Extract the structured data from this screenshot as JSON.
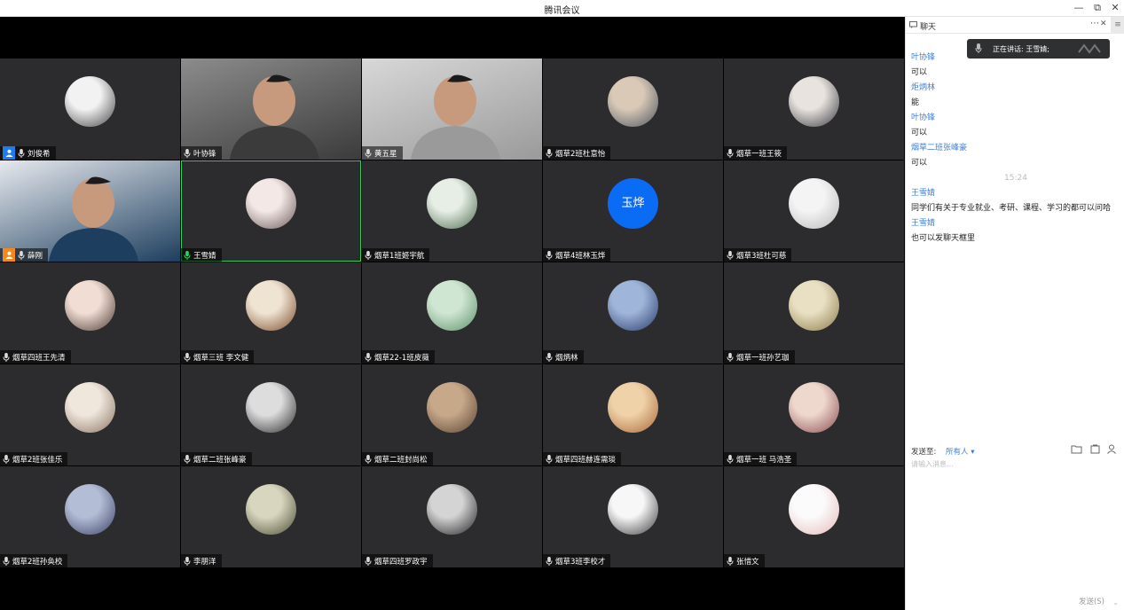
{
  "window": {
    "title": "腾讯会议",
    "minimize": "—",
    "restore": "⧉",
    "close": "✕"
  },
  "participants": [
    {
      "name": "刘俊希",
      "kind": "avatar",
      "color1": "#f2f2f2",
      "color2": "#444444",
      "host": true
    },
    {
      "name": "叶协锋",
      "kind": "video",
      "color1": "#8c8c8c",
      "color2": "#3b3b3b"
    },
    {
      "name": "黄五星",
      "kind": "video",
      "color1": "#d8d8d8",
      "color2": "#9a9a9a"
    },
    {
      "name": "烟草2班杜意怡",
      "kind": "avatar",
      "color1": "#d9c9b6",
      "color2": "#4c5460"
    },
    {
      "name": "烟草一班王筱",
      "kind": "avatar",
      "color1": "#e8e3df",
      "color2": "#3a3a40"
    },
    {
      "name": "薛刚",
      "kind": "video",
      "color1": "#e6e9ee",
      "color2": "#1d3e5e",
      "host": true
    },
    {
      "name": "王雪婧",
      "kind": "avatar",
      "color1": "#f3e8e6",
      "color2": "#6b5a58",
      "active": true
    },
    {
      "name": "烟草1班姬宇航",
      "kind": "avatar",
      "color1": "#e6eee5",
      "color2": "#4e6b50"
    },
    {
      "name": "烟草4班林玉烨",
      "kind": "text",
      "avatar_text": "玉烨"
    },
    {
      "name": "烟草3班杜可慈",
      "kind": "avatar",
      "color1": "#f4f4f4",
      "color2": "#b9b9b9"
    },
    {
      "name": "烟草四班王先清",
      "kind": "avatar",
      "color1": "#f1ddd3",
      "color2": "#4a3a34"
    },
    {
      "name": "烟草三班 李文健",
      "kind": "avatar",
      "color1": "#efe3d2",
      "color2": "#7a4a2a"
    },
    {
      "name": "烟草22-1班皮薇",
      "kind": "avatar",
      "color1": "#cfe6d2",
      "color2": "#5d8f6b"
    },
    {
      "name": "烟炳林",
      "kind": "avatar",
      "color1": "#9fb5d9",
      "color2": "#283a6a"
    },
    {
      "name": "烟草一班孙艺珈",
      "kind": "avatar",
      "color1": "#e9e0c3",
      "color2": "#8a7a4a"
    },
    {
      "name": "烟草2班张佳乐",
      "kind": "avatar",
      "color1": "#efe6dc",
      "color2": "#8a7362"
    },
    {
      "name": "烟草二班张峰豪",
      "kind": "avatar",
      "color1": "#dddddd",
      "color2": "#2a2a2a"
    },
    {
      "name": "烟草二班封尚松",
      "kind": "avatar",
      "color1": "#c7a98a",
      "color2": "#5a4232"
    },
    {
      "name": "烟草四班赫连需琰",
      "kind": "avatar",
      "color1": "#f0d2a8",
      "color2": "#a8663a"
    },
    {
      "name": "烟草一班 马浩圣",
      "kind": "avatar",
      "color1": "#eed7cc",
      "color2": "#8a4a52"
    },
    {
      "name": "烟草2班孙奂校",
      "kind": "avatar",
      "color1": "#b4bdd6",
      "color2": "#3b4266"
    },
    {
      "name": "李朋洋",
      "kind": "avatar",
      "color1": "#d8d6bf",
      "color2": "#4a4a32"
    },
    {
      "name": "烟草四班罗政宇",
      "kind": "avatar",
      "color1": "#d4d4d4",
      "color2": "#1f1f1f"
    },
    {
      "name": "烟草3班李校才",
      "kind": "avatar",
      "color1": "#f7f7f7",
      "color2": "#3a3a3a"
    },
    {
      "name": "张惜文",
      "kind": "avatar",
      "color1": "#fbfbfb",
      "color2": "#e7b9b9"
    }
  ],
  "chat": {
    "title": "聊天",
    "more": "⋯",
    "close": "✕",
    "speaking": "正在讲话: 王雪婧;",
    "messages": [
      {
        "type": "name",
        "text": "叶协锋"
      },
      {
        "type": "text",
        "text": "可以"
      },
      {
        "type": "name",
        "text": "炬炳林"
      },
      {
        "type": "text",
        "text": "能"
      },
      {
        "type": "name",
        "text": "叶协锋"
      },
      {
        "type": "text",
        "text": "可以"
      },
      {
        "type": "name",
        "text": "烟草二班张峰豪"
      },
      {
        "type": "text",
        "text": "可以"
      },
      {
        "type": "time",
        "text": "15:24"
      },
      {
        "type": "name",
        "text": "王雪婧"
      },
      {
        "type": "text",
        "text": "同学们有关于专业就业、考研、课程、学习的都可以问哈"
      },
      {
        "type": "name",
        "text": "王雪婧"
      },
      {
        "type": "text",
        "text": "也可以发聊天框里"
      }
    ],
    "send_to_label": "发送至:",
    "send_to_target": "所有人 ▾",
    "input_placeholder": "请输入消息...",
    "send_button": "发送(S)",
    "send_dropdown": "⌄"
  }
}
